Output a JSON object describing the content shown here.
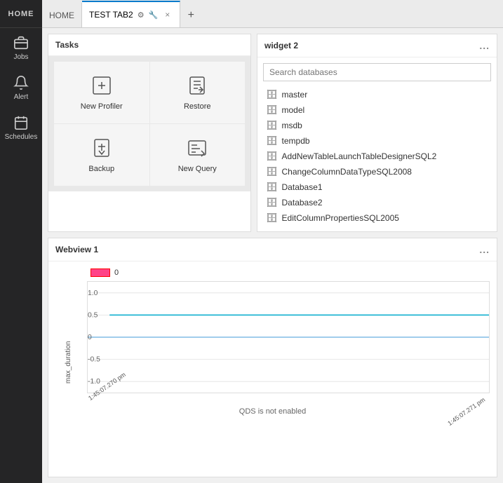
{
  "sidebar": {
    "home_label": "HOME",
    "items": [
      {
        "id": "jobs",
        "label": "Jobs",
        "icon": "briefcase"
      },
      {
        "id": "alert",
        "label": "Alert",
        "icon": "bell"
      },
      {
        "id": "schedules",
        "label": "Schedules",
        "icon": "calendar"
      }
    ]
  },
  "tabs": {
    "inactive": {
      "label": "HOME"
    },
    "active": {
      "label": "TEST TAB2",
      "icon1": "⚙",
      "icon2": "🔧"
    },
    "close_icon": "×",
    "add_icon": "+"
  },
  "tasks_widget": {
    "title": "Tasks",
    "items": [
      {
        "id": "new-profiler",
        "label": "New Profiler"
      },
      {
        "id": "restore",
        "label": "Restore"
      },
      {
        "id": "backup",
        "label": "Backup"
      },
      {
        "id": "new-query",
        "label": "New Query"
      }
    ]
  },
  "db_widget": {
    "title": "widget 2",
    "more_icon": "...",
    "search_placeholder": "Search databases",
    "databases": [
      {
        "name": "master"
      },
      {
        "name": "model"
      },
      {
        "name": "msdb"
      },
      {
        "name": "tempdb"
      },
      {
        "name": "AddNewTableLaunchTableDesignerSQL2"
      },
      {
        "name": "ChangeColumnDataTypeSQL2008"
      },
      {
        "name": "Database1"
      },
      {
        "name": "Database2"
      },
      {
        "name": "EditColumnPropertiesSQL2005"
      }
    ]
  },
  "webview_widget": {
    "title": "Webview 1",
    "more_icon": "...",
    "legend_value": "0",
    "y_axis_label": "max_duration",
    "x_label_left": "1:45:07.270 pm",
    "x_label_right": "1:45:07.271 pm",
    "footer_text": "QDS is not enabled",
    "chart": {
      "y_ticks": [
        "1.0",
        "0.5",
        "0",
        "-0.5",
        "-1.0"
      ],
      "line_y": 0.5
    }
  }
}
